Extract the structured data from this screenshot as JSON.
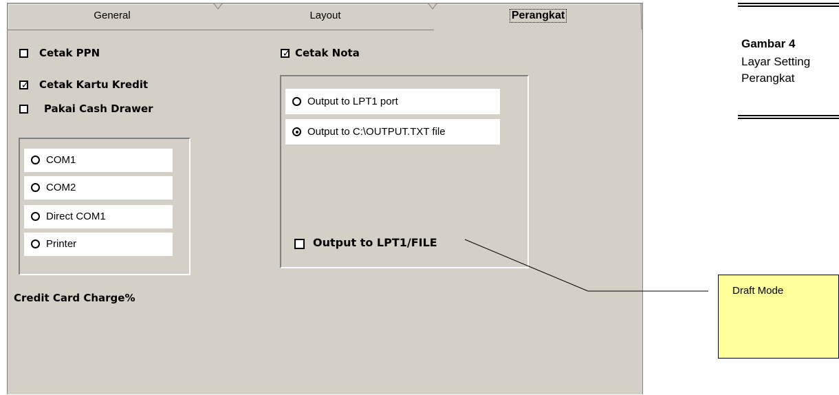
{
  "tabs": {
    "general": "General",
    "layout": "Layout",
    "perangkat": "Perangkat"
  },
  "left": {
    "cetak_ppn": {
      "label": "Cetak PPN",
      "checked": false
    },
    "cetak_kartu_kredit": {
      "label": "Cetak Kartu Kredit",
      "checked": true
    },
    "pakai_cash_drawer": {
      "label": "Pakai Cash Drawer",
      "checked": false
    },
    "drawer_options": [
      "COM1",
      "COM2",
      "Direct COM1",
      "Printer"
    ],
    "credit_card_charge_label": "Credit Card Charge%"
  },
  "right": {
    "cetak_nota": {
      "label": "Cetak Nota",
      "checked": true
    },
    "output_options": [
      {
        "label": "Output to LPT1 port",
        "selected": false
      },
      {
        "label": "Output to C:\\OUTPUT.TXT file",
        "selected": true
      }
    ],
    "draft_mode": {
      "label": "Output to LPT1/FILE",
      "checked": false
    }
  },
  "callout": {
    "note": "Draft Mode",
    "background": "#ffff99"
  },
  "caption": {
    "title": "Gambar 4",
    "line1": "Layar Setting",
    "line2": "Perangkat"
  },
  "colors": {
    "dialog_bg": "#d4d0c8"
  }
}
